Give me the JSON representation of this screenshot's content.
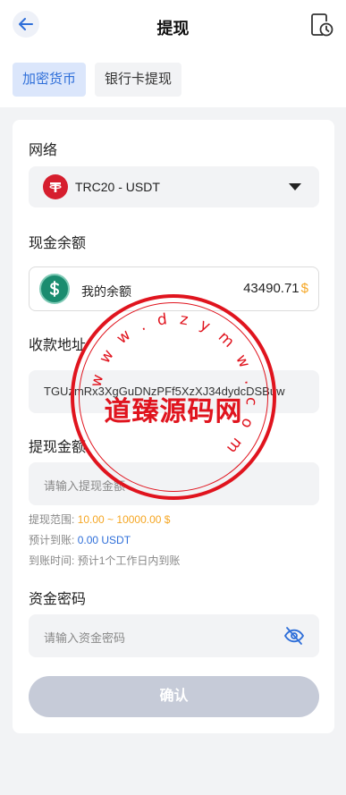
{
  "header": {
    "title": "提现"
  },
  "tabs": [
    {
      "label": "加密货币",
      "active": true
    },
    {
      "label": "银行卡提现",
      "active": false
    }
  ],
  "network": {
    "label": "网络",
    "selected": "TRC20 - USDT"
  },
  "balance": {
    "section_label": "现金余额",
    "label": "我的余额",
    "amount": "43490.71",
    "currency": "$"
  },
  "address": {
    "label": "收款地址",
    "value": "TGUzmRx3XgGuDNzPFf5XzXJ34dydcDSBuw"
  },
  "amount": {
    "label": "提现金额",
    "placeholder": "请输入提现金额",
    "range_label": "提现范围:",
    "range_value": "10.00 ~ 10000.00 $",
    "expected_label": "预计到账:",
    "expected_value": "0.00 USDT",
    "arrival_label": "到账时间:",
    "arrival_value": "预计1个工作日内到账"
  },
  "password": {
    "label": "资金密码",
    "placeholder": "请输入资金密码"
  },
  "confirm_label": "确认",
  "stamp": {
    "ring_text": "w w w . d z y m w . c o m",
    "center_text": "道臻源码网"
  },
  "colors": {
    "accent": "#2f6fd9",
    "orange": "#f5a623",
    "stamp_red": "#e0141e",
    "button_disabled": "#c6cbd8"
  }
}
